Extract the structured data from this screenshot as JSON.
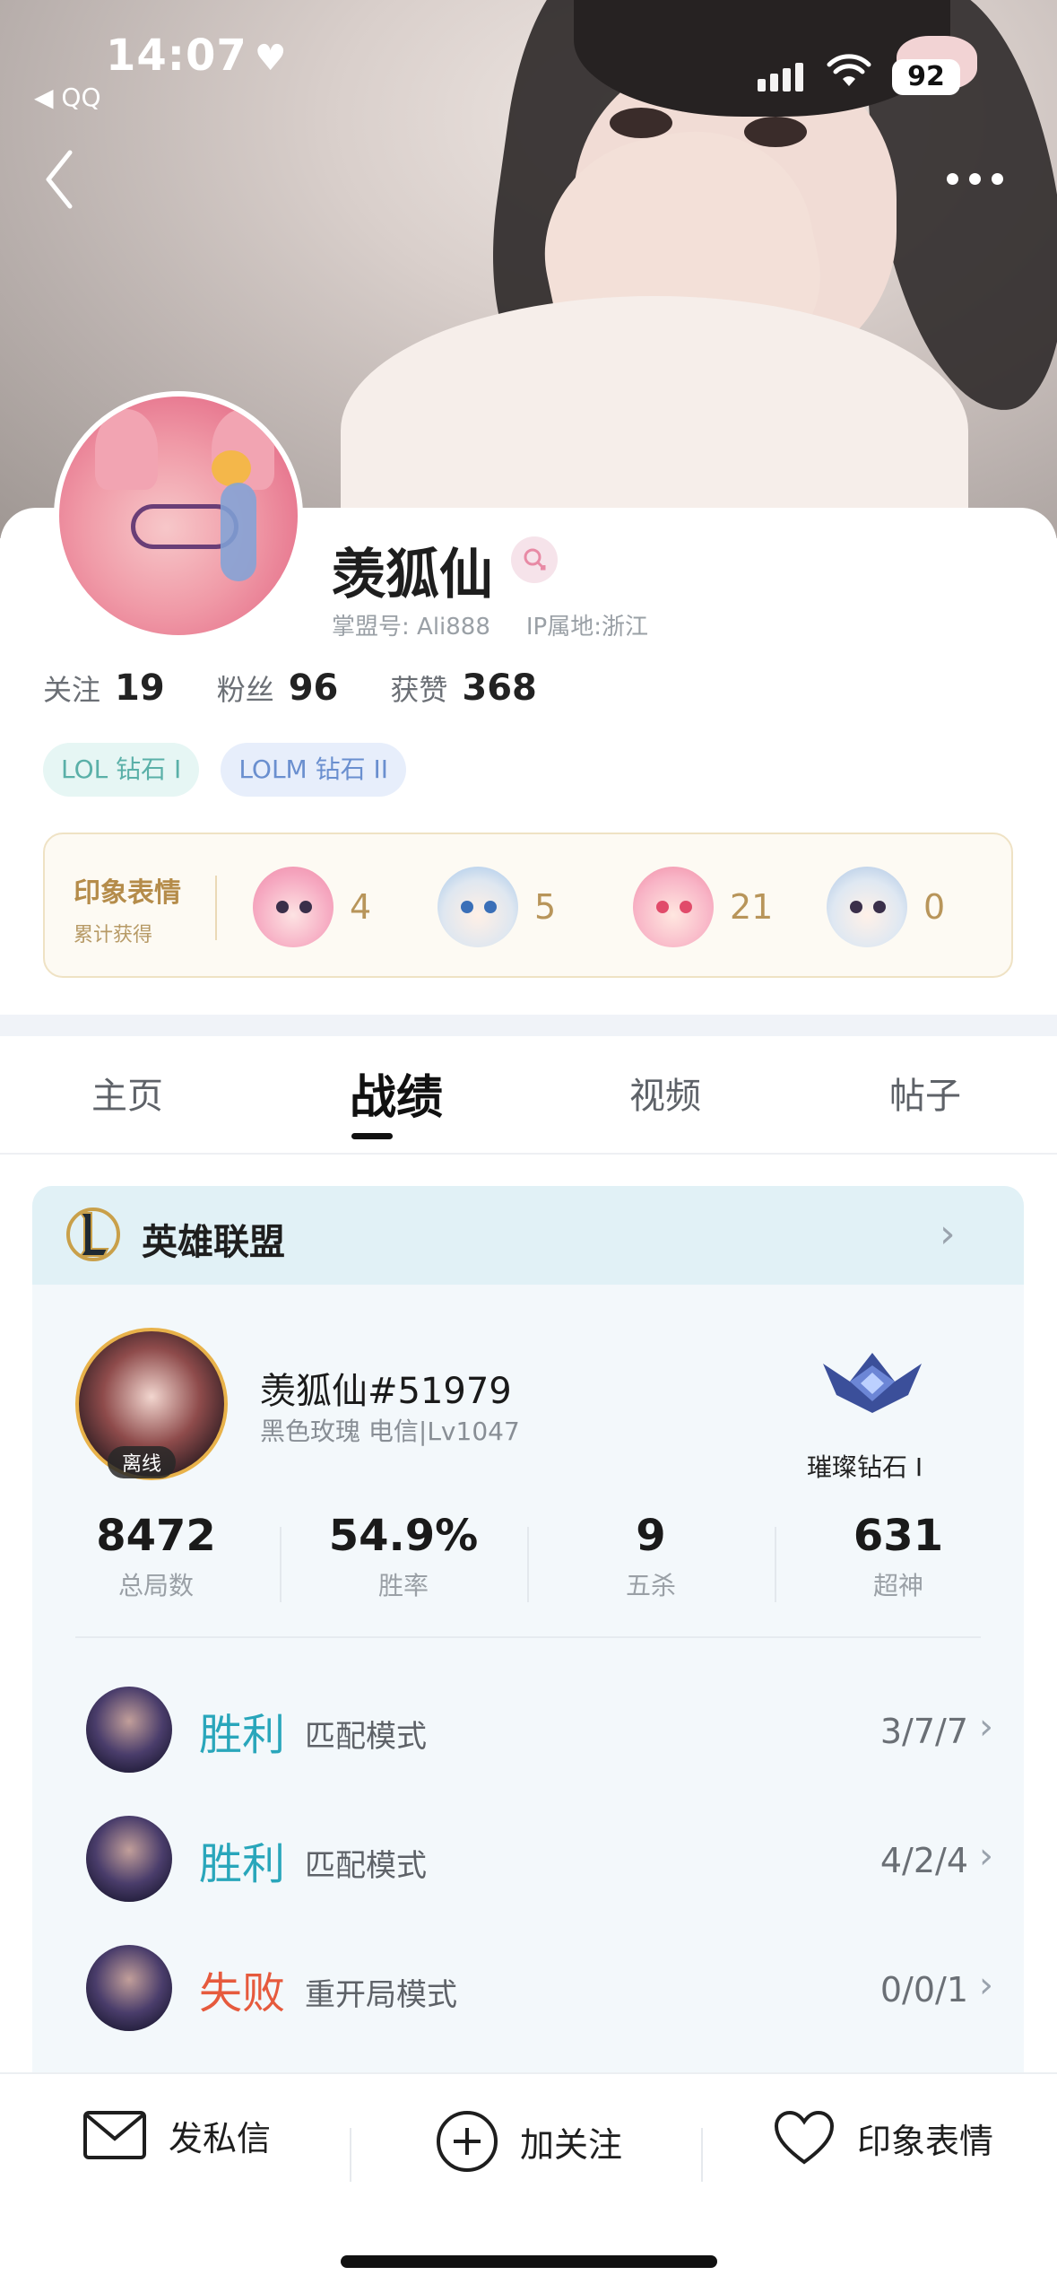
{
  "status_bar": {
    "time": "14:07",
    "back_app": "◀ QQ",
    "battery": "92"
  },
  "profile": {
    "username": "羡狐仙",
    "account_label": "掌盟号:",
    "account_id": "Ali888",
    "ip_label": "IP属地:",
    "ip_location": "浙江",
    "stats": [
      {
        "label": "关注",
        "value": "19"
      },
      {
        "label": "粉丝",
        "value": "96"
      },
      {
        "label": "获赞",
        "value": "368"
      }
    ],
    "rank_tags": [
      "LOL 钻石 I",
      "LOLM 钻石 II"
    ]
  },
  "impression": {
    "title": "印象表情",
    "subtitle": "累计获得",
    "items": [
      {
        "icon": "blush-girl-emoji-icon",
        "count": "4"
      },
      {
        "icon": "waving-boy-emoji-icon",
        "count": "5"
      },
      {
        "icon": "love-girl-emoji-icon",
        "count": "21"
      },
      {
        "icon": "gg-boy-emoji-icon",
        "count": "0"
      }
    ]
  },
  "tabs": [
    {
      "label": "主页",
      "active": false
    },
    {
      "label": "战绩",
      "active": true
    },
    {
      "label": "视频",
      "active": false
    },
    {
      "label": "帖子",
      "active": false
    }
  ],
  "game": {
    "title": "英雄联盟",
    "summoner": "羡狐仙#51979",
    "server": "黑色玫瑰 电信|Lv1047",
    "status": "离线",
    "tier": "璀璨钻石 I",
    "kpis": [
      {
        "value": "8472",
        "label": "总局数"
      },
      {
        "value": "54.9%",
        "label": "胜率"
      },
      {
        "value": "9",
        "label": "五杀"
      },
      {
        "value": "631",
        "label": "超神"
      }
    ],
    "matches": [
      {
        "result": "胜利",
        "outcome": "win",
        "mode": "匹配模式",
        "kda": "3/7/7"
      },
      {
        "result": "胜利",
        "outcome": "win",
        "mode": "匹配模式",
        "kda": "4/2/4"
      },
      {
        "result": "失败",
        "outcome": "lose",
        "mode": "重开局模式",
        "kda": "0/0/1"
      }
    ]
  },
  "bottom_bar": {
    "message": "发私信",
    "follow": "加关注",
    "impression": "印象表情"
  }
}
